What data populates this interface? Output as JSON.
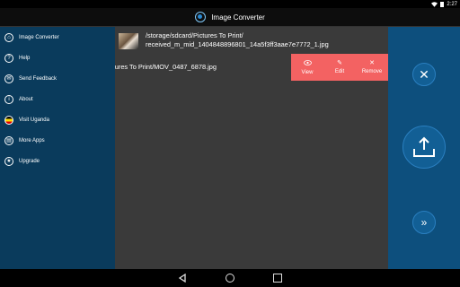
{
  "status_bar": {
    "time": "2:27"
  },
  "app_bar": {
    "title": "Image Converter",
    "icon": "app-logo-icon"
  },
  "sidebar": {
    "items": [
      {
        "label": "Image Converter",
        "icon": "home-icon"
      },
      {
        "label": "Help",
        "icon": "help-icon"
      },
      {
        "label": "Send Feedback",
        "icon": "mail-icon"
      },
      {
        "label": "About",
        "icon": "info-icon"
      },
      {
        "label": "Visit Uganda",
        "icon": "uganda-flag-icon"
      },
      {
        "label": "More Apps",
        "icon": "store-icon"
      },
      {
        "label": "Upgrade",
        "icon": "star-icon"
      }
    ]
  },
  "files": [
    {
      "line1": "/storage/sdcard/Pictures To Print/",
      "line2": "received_m_mid_1404848896801_14a5f3ff3aae7e7772_1.jpg",
      "has_thumbnail": true
    },
    {
      "line1": "ctures To Print/MOV_0487_6878.jpg"
    }
  ],
  "actions": [
    {
      "label": "View",
      "icon": "eye-icon"
    },
    {
      "label": "Edit",
      "icon": "edit-icon"
    },
    {
      "label": "Remove",
      "icon": "close-icon"
    }
  ],
  "action_bar_color": "#f36262",
  "sidebar_color": "#0a3b5c",
  "right_panel_color": "#0d4f7d",
  "right_panel_buttons": [
    "clear-icon",
    "upload-icon",
    "next-icon"
  ]
}
